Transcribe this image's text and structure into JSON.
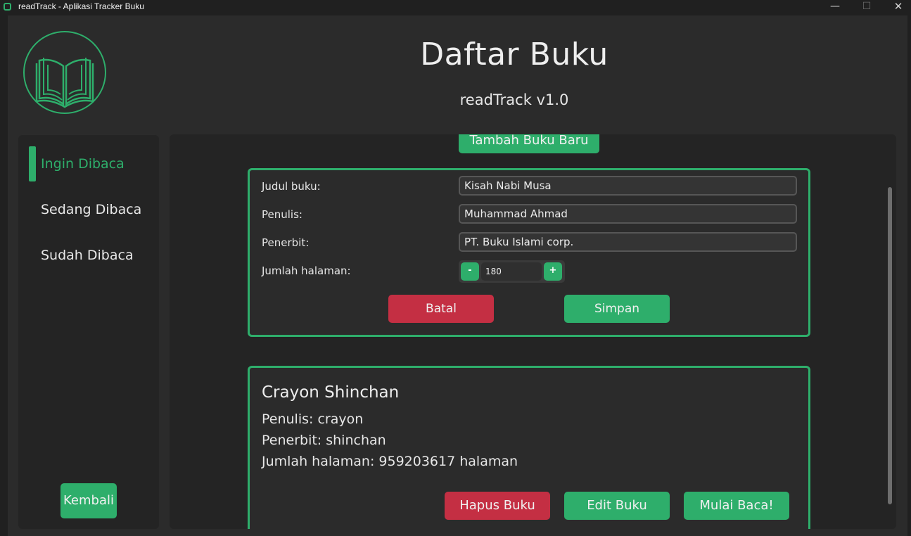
{
  "window": {
    "title": "readTrack - Aplikasi Tracker Buku",
    "controls": {
      "minimize": "—",
      "maximize": "☐",
      "close": "✕"
    }
  },
  "header": {
    "title": "Daftar Buku",
    "subtitle": "readTrack v1.0",
    "logo_icon": "open-book-icon"
  },
  "sidebar": {
    "items": [
      {
        "label": "Ingin Dibaca",
        "active": true
      },
      {
        "label": "Sedang Dibaca",
        "active": false
      },
      {
        "label": "Sudah Dibaca",
        "active": false
      }
    ],
    "back_label": "Kembali"
  },
  "main": {
    "add_book_label": "Tambah Buku Baru",
    "form": {
      "title_label": "Judul buku:",
      "title_value": "Kisah Nabi Musa",
      "author_label": "Penulis:",
      "author_value": "Muhammad Ahmad",
      "publisher_label": "Penerbit:",
      "publisher_value": "PT. Buku Islami corp.",
      "pages_label": "Jumlah halaman:",
      "pages_value": "180",
      "decrement_label": "-",
      "increment_label": "+",
      "cancel_label": "Batal",
      "save_label": "Simpan"
    },
    "books": [
      {
        "title": "Crayon Shinchan",
        "author_line": "Penulis: crayon",
        "publisher_line": "Penerbit: shinchan",
        "pages_line": "Jumlah halaman: 959203617 halaman",
        "delete_label": "Hapus Buku",
        "edit_label": "Edit Buku",
        "start_label": "Mulai Baca!"
      }
    ]
  },
  "colors": {
    "accent": "#2eae6b",
    "danger": "#c42f43",
    "background": "#2b2b2b",
    "panel": "#242424"
  }
}
